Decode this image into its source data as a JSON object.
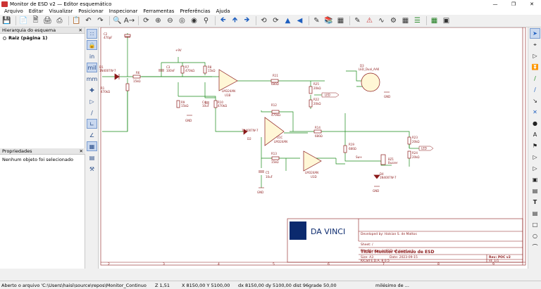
{
  "window": {
    "title": "Monitor de ESD v2 — Editor esquemático",
    "controls": [
      "—",
      "❐",
      "✕"
    ]
  },
  "menu": [
    "Arquivo",
    "Editar",
    "Visualizar",
    "Posicionar",
    "Inspecionar",
    "Ferramentas",
    "Preferências",
    "Ajuda"
  ],
  "panels": {
    "hierarchy": {
      "title": "Hierarquia do esquema",
      "root": "Raiz (página 1)"
    },
    "properties": {
      "title": "Propriedades",
      "empty": "Nenhum objeto foi selecionado"
    }
  },
  "left_tools": {
    "units_in": "in",
    "units_mil": "mil",
    "units_mm": "mm"
  },
  "schematic": {
    "labels": {
      "c2": "C2",
      "c2v": "470pF",
      "d1": "D1",
      "d1v": "1N4007W-7",
      "r1": "R1",
      "r1v": "470kΩ",
      "r6": "R6",
      "r6v": "15kΩ",
      "vcc": "+9V",
      "c3": "C3",
      "c3v": "100nF",
      "r7": "R7",
      "r7v": "470kΩ",
      "r8": "R8",
      "r8v": "15kΩ",
      "u1a": "LM324AN",
      "u1av": "U1B",
      "r9": "R9",
      "r9v": "15kΩ",
      "c4": "C4",
      "c4v": "10uF",
      "r10": "R10",
      "r10v": "470kΩ",
      "gnd": "GND",
      "r11": "R11",
      "r11v": "680Ω",
      "r25": "R25",
      "r25v": "20kΩ",
      "r22": "R22",
      "r22v": "20kΩ",
      "led": "LED",
      "d3": "D3",
      "d3v": "LED_Dual_AAK",
      "d2n": "1N4007W-7",
      "d2": "D2",
      "r12": "R12",
      "r12v": "470kΩ",
      "u1c": "U1C",
      "u1cv": "LM324AN",
      "r14": "R14",
      "r14v": "680Ω",
      "r19": "R19",
      "r19v": "680Ω",
      "r13": "R13",
      "r13v": "15kΩ",
      "c5": "C5",
      "c5v": "10uF",
      "u1d": "LM324AN",
      "u1dv": "U1D",
      "sw": "Sw+",
      "bz": "BZ1",
      "bzv": "Buzzer",
      "d4": "D4",
      "d4v": "1N4007W-7",
      "r23": "R23",
      "r23v": "20kΩ",
      "r24": "R24",
      "r24v": "20kΩ",
      "led2": "LED"
    },
    "titleblock": {
      "logo": "DA VINCI",
      "developed": "Developed by: Halsian S. de Mattos",
      "sheet": "Sheet: /",
      "file": "File: Monitor de ESD v2.kicad_sch",
      "title": "Title: Monitor Contínuo de ESD",
      "size": "Size: A3",
      "date": "Date: 2023-09-15",
      "rev": "Rev: POC v2",
      "kicad": "KiCad E.D.A. 8.0.5",
      "id": "Id: 1/1"
    },
    "border_numbers": [
      "2",
      "3",
      "4",
      "5",
      "6",
      "7",
      "8",
      "9"
    ]
  },
  "status": {
    "file": "Aberto o arquivo 'C:\\Users\\haisi\\source\\repos\\Monitor_Continuo_de_ESD\\Hardware\\M...",
    "zoom": "Z 1,51",
    "xy": "X 8150,00  Y 5100,00",
    "dxy": "dx 8150,00  dy 5100,00  dist 9614,18",
    "grid": "grade 50,00",
    "units": "milésimo de ..."
  }
}
